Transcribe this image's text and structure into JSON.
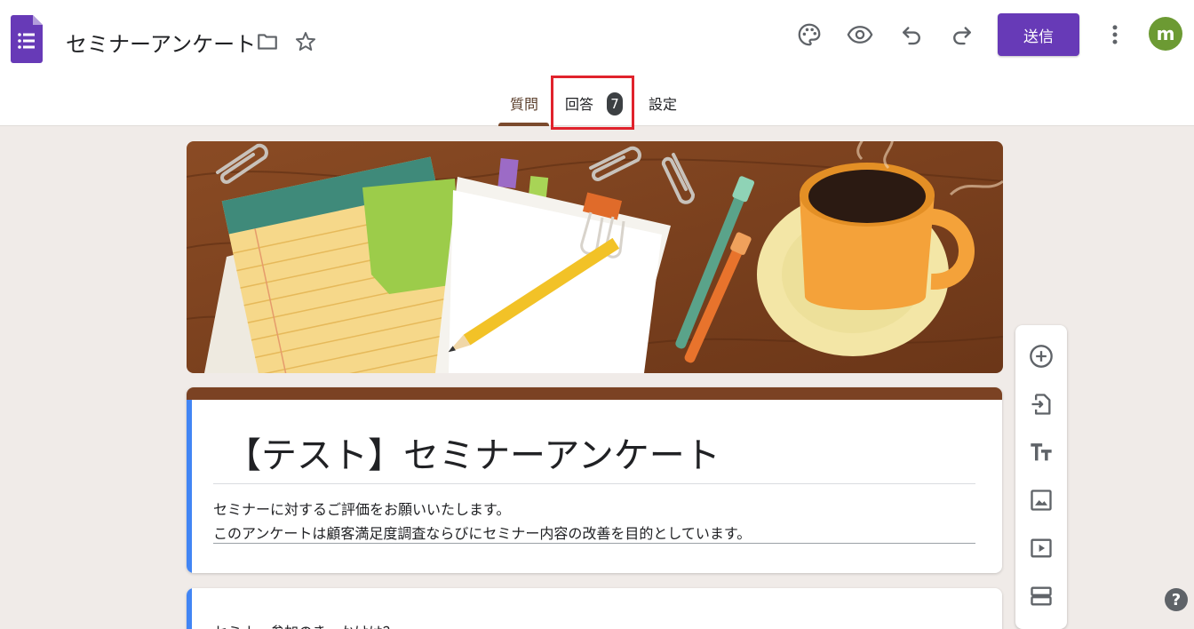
{
  "header": {
    "doc_title": "セミナーアンケート",
    "send_label": "送信",
    "avatar_initial": "m",
    "icons": [
      "forms-logo-icon",
      "folder-icon",
      "star-icon",
      "palette-icon",
      "eye-icon",
      "undo-icon",
      "redo-icon",
      "more-vert-icon"
    ]
  },
  "tabs": {
    "questions": "質問",
    "responses": "回答",
    "responses_count": "7",
    "settings": "設定"
  },
  "form": {
    "title": "【テスト】セミナーアンケート",
    "description_line1": "セミナーに対するご評価をお願いいたします。",
    "description_line2": "このアンケートは顧客満足度調査ならびにセミナー内容の改善を目的としています。",
    "question1": "セミナー参加のきっかけは？"
  },
  "toolbar": {
    "icons": [
      "add-question-icon",
      "import-questions-icon",
      "add-title-icon",
      "add-image-icon",
      "add-video-icon",
      "add-section-icon"
    ]
  },
  "help": "?",
  "colors": {
    "accent": "#673ab7",
    "theme_band": "#7b4223",
    "left_band": "#4285f4",
    "highlight": "#e0232c",
    "background": "#f0ebe8"
  }
}
